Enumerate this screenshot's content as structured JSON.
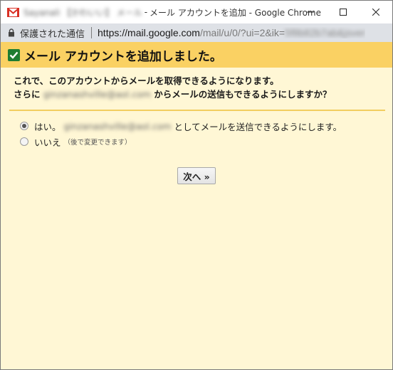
{
  "window": {
    "title_account_blurred": "Sayanali 【かわいい】 メール",
    "title_separator": "-",
    "title_text": "メール アカウントを追加 - Google Chrome"
  },
  "addressbar": {
    "security_label": "保護された通信",
    "url_host": "https://mail.google.com",
    "url_path": "/mail/u/0/?ui=2&ik=",
    "url_blurred": "5f8b82b7ab&jsver"
  },
  "page": {
    "header_title": "メール アカウントを追加しました。",
    "intro_line1": "これで、このアカウントからメールを取得できるようになります。",
    "intro_line2_prefix": "さらに",
    "intro_email_blurred": "ginzanashville@aol.com",
    "intro_line2_suffix": "からメールの送信もできるようにしますか？",
    "options": [
      {
        "label_prefix": "はい。",
        "email_blurred": "ginzanashville@aol.com",
        "label_suffix": "としてメールを送信できるようにします。",
        "selected": true
      },
      {
        "label": "いいえ",
        "note": "（後で変更できます）",
        "selected": false
      }
    ],
    "next_button": "次へ »"
  },
  "colors": {
    "header_band": "#fad163",
    "page_background": "#fff7d5",
    "check_green": "#1e7d32",
    "gmail_red": "#d93025"
  }
}
